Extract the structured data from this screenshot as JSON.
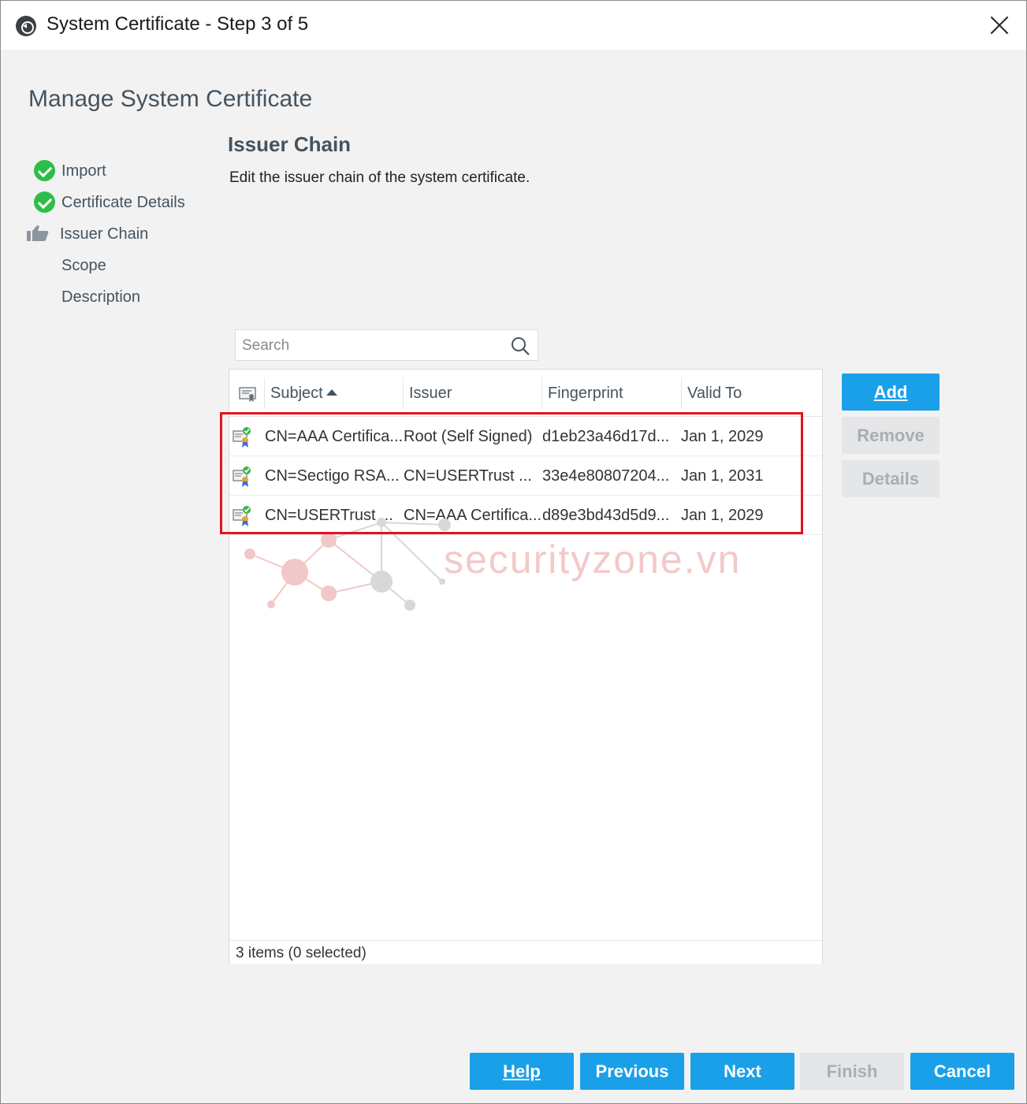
{
  "window": {
    "title": "System Certificate - Step 3 of 5"
  },
  "page": {
    "title": "Manage System Certificate"
  },
  "steps": [
    {
      "label": "Import",
      "state": "done",
      "icon": "check-circle-icon"
    },
    {
      "label": "Certificate Details",
      "state": "done",
      "icon": "check-circle-icon"
    },
    {
      "label": "Issuer Chain",
      "state": "current",
      "icon": "thumbs-up-icon"
    },
    {
      "label": "Scope",
      "state": "pending"
    },
    {
      "label": "Description",
      "state": "pending"
    }
  ],
  "section": {
    "title": "Issuer Chain",
    "description": "Edit the issuer chain of the system certificate."
  },
  "search": {
    "placeholder": "Search",
    "value": ""
  },
  "table": {
    "columns": [
      "Subject",
      "Issuer",
      "Fingerprint",
      "Valid To"
    ],
    "sort": {
      "column": "Subject",
      "direction": "ascending"
    },
    "rows": [
      {
        "subject": "CN=AAA Certifica...",
        "issuer": "Root (Self Signed)",
        "fingerprint": "d1eb23a46d17d...",
        "valid_to": "Jan 1, 2029"
      },
      {
        "subject": "CN=Sectigo RSA...",
        "issuer": "CN=USERTrust ...",
        "fingerprint": "33e4e80807204...",
        "valid_to": "Jan 1, 2031"
      },
      {
        "subject": "CN=USERTrust ...",
        "issuer": "CN=AAA Certifica...",
        "fingerprint": "d89e3bd43d5d9...",
        "valid_to": "Jan 1, 2029"
      }
    ],
    "footer": "3 items (0 selected)"
  },
  "side_buttons": {
    "add": "Add",
    "remove": "Remove",
    "details": "Details"
  },
  "footer_buttons": {
    "help": "Help",
    "previous": "Previous",
    "next": "Next",
    "finish": "Finish",
    "cancel": "Cancel"
  },
  "watermark": {
    "text": "securityzone.vn"
  },
  "colors": {
    "primary_button": "#1aa0e8",
    "disabled_button": "#e4e6e8",
    "done_check": "#2ebd48",
    "highlight_box": "#e4121b",
    "heading_text": "#44535f"
  }
}
